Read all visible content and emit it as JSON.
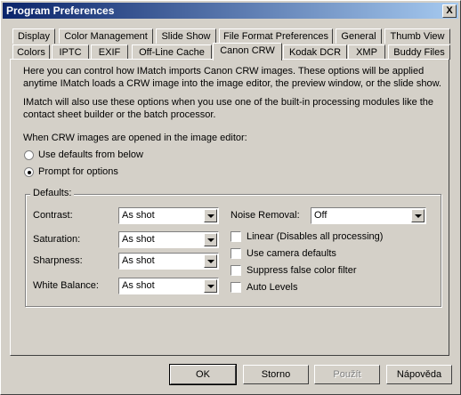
{
  "window": {
    "title": "Program Preferences",
    "close_label": "X"
  },
  "tabs_row1": [
    "Display",
    "Color Management",
    "Slide Show",
    "File Format Preferences",
    "General",
    "Thumb View"
  ],
  "tabs_row2": [
    "Colors",
    "IPTC",
    "EXIF",
    "Off-Line Cache",
    "Canon CRW",
    "Kodak DCR",
    "XMP",
    "Buddy Files"
  ],
  "active_tab": "Canon CRW",
  "intro": {
    "p1": "Here you can control how IMatch imports Canon CRW images. These options will be applied anytime IMatch loads a CRW image into the image editor, the preview window, or the slide show.",
    "p2": "IMatch will also use these options when you use one of the built-in processing modules like the contact sheet builder or the batch processor."
  },
  "open_section": {
    "label": "When CRW images are opened in the image editor:",
    "option_defaults": "Use defaults from below",
    "option_prompt": "Prompt for options",
    "selected": "Prompt for options"
  },
  "defaults": {
    "title": "Defaults:",
    "contrast": {
      "label": "Contrast:",
      "value": "As shot"
    },
    "saturation": {
      "label": "Saturation:",
      "value": "As shot"
    },
    "sharpness": {
      "label": "Sharpness:",
      "value": "As shot"
    },
    "white_balance": {
      "label": "White Balance:",
      "value": "As shot"
    },
    "noise_removal": {
      "label": "Noise Removal:",
      "value": "Off"
    },
    "linear": {
      "label": "Linear (Disables all processing)",
      "checked": false
    },
    "camera_defaults": {
      "label": "Use camera defaults",
      "checked": false
    },
    "suppress_false_color": {
      "label": "Suppress false color filter",
      "checked": false
    },
    "auto_levels": {
      "label": "Auto Levels",
      "checked": false
    }
  },
  "buttons": {
    "ok": "OK",
    "cancel": "Storno",
    "apply": "Použít",
    "help": "Nápověda"
  }
}
